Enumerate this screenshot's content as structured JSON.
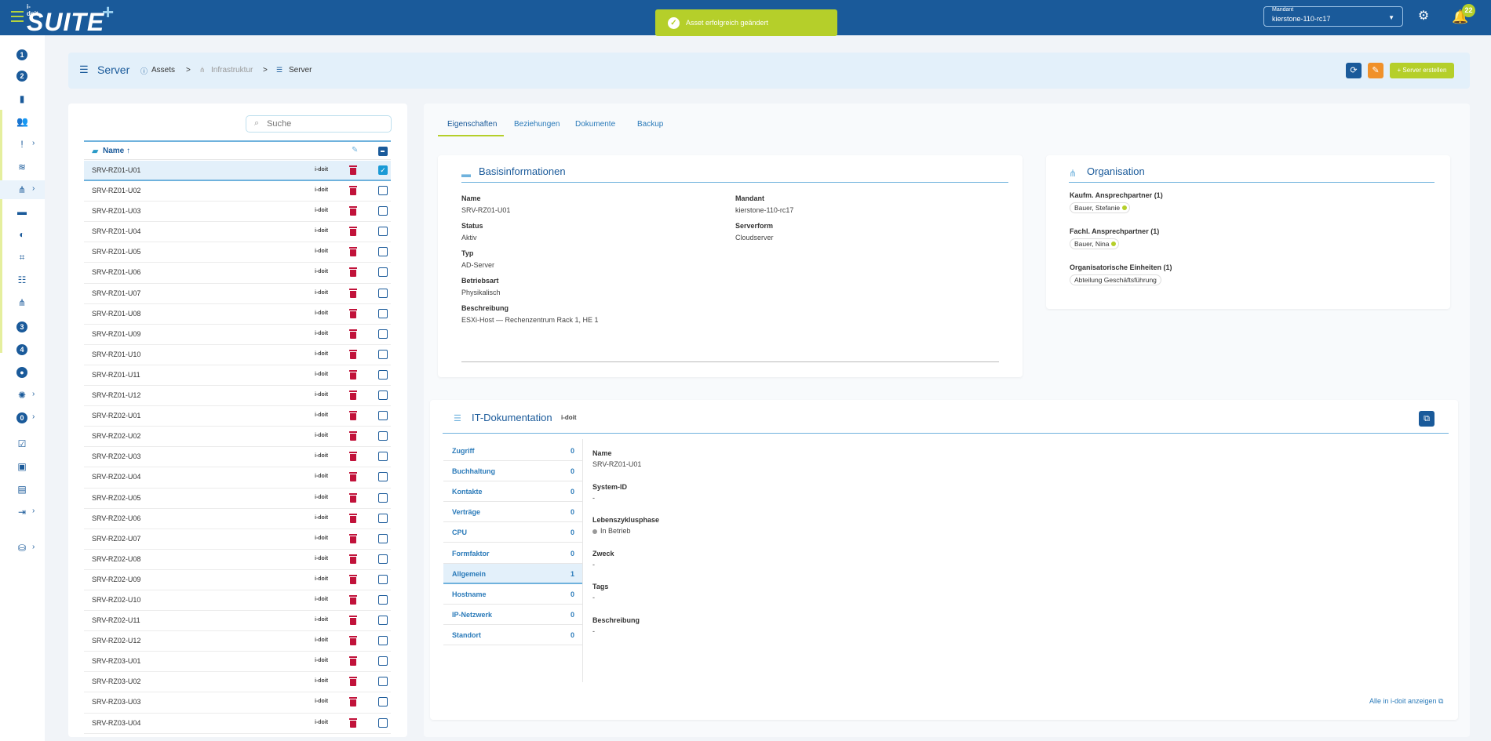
{
  "app": {
    "logo_sub": "i-doit",
    "logo_main": "SUITE",
    "logo_plus": "+"
  },
  "toast": {
    "message": "Asset erfolgreich geändert"
  },
  "topbar": {
    "mandant_label": "Mandant",
    "mandant_value": "kierstone-110-rc17",
    "notifications": "22"
  },
  "sidebar": {
    "items": [
      {
        "icon": "one-circle-icon",
        "glyph": "1",
        "circle": true,
        "chev": false
      },
      {
        "icon": "two-circle-icon",
        "glyph": "2",
        "circle": true,
        "chev": false
      },
      {
        "icon": "bar-chart-icon",
        "glyph": "▮",
        "circle": false,
        "chev": false
      },
      {
        "icon": "users-icon",
        "glyph": "👥",
        "circle": false,
        "chev": false
      },
      {
        "icon": "alert-icon",
        "glyph": "!",
        "circle": false,
        "chev": true
      },
      {
        "icon": "layers-icon",
        "glyph": "≋",
        "circle": false,
        "chev": false
      },
      {
        "icon": "network-icon",
        "glyph": "⋔",
        "circle": false,
        "chev": true,
        "active": true
      },
      {
        "icon": "truck-icon",
        "glyph": "▬",
        "circle": false,
        "chev": false
      },
      {
        "icon": "toggle-icon",
        "glyph": "◐",
        "circle": false,
        "chev": false
      },
      {
        "icon": "scan-icon",
        "glyph": "⌗",
        "circle": false,
        "chev": false
      },
      {
        "icon": "tree-list-icon",
        "glyph": "☷",
        "circle": false,
        "chev": false
      },
      {
        "icon": "hierarchy-icon",
        "glyph": "⋔",
        "circle": false,
        "chev": false
      },
      {
        "icon": "three-circle-icon",
        "glyph": "3",
        "circle": true,
        "chev": false
      },
      {
        "icon": "four-circle-icon",
        "glyph": "4",
        "circle": true,
        "chev": false
      },
      {
        "icon": "drop-circle-icon",
        "glyph": "●",
        "circle": true,
        "chev": false
      },
      {
        "icon": "sun-alert-icon",
        "glyph": "✺",
        "circle": false,
        "chev": true
      },
      {
        "icon": "zero-circle-icon",
        "glyph": "0",
        "circle": true,
        "chev": true
      },
      {
        "icon": "checklist-icon",
        "glyph": "☑",
        "circle": false,
        "chev": false
      },
      {
        "icon": "image-report-icon",
        "glyph": "▣",
        "circle": false,
        "chev": false
      },
      {
        "icon": "document-icon",
        "glyph": "▤",
        "circle": false,
        "chev": false
      },
      {
        "icon": "login-icon",
        "glyph": "⇥",
        "circle": false,
        "chev": true
      },
      {
        "icon": "database-icon",
        "glyph": "⛁",
        "circle": false,
        "chev": true
      }
    ]
  },
  "header": {
    "title": "Server",
    "breadcrumb": [
      "Assets",
      "Infrastruktur",
      "Server"
    ],
    "separator": ">",
    "refresh_icon": "⟳",
    "edit_icon": "✎",
    "create_label": "+  Server erstellen"
  },
  "list": {
    "search_placeholder": "Suche",
    "column_name": "Name ↑",
    "idoit_label": "i-doit",
    "rows": [
      "SRV-RZ01-U01",
      "SRV-RZ01-U02",
      "SRV-RZ01-U03",
      "SRV-RZ01-U04",
      "SRV-RZ01-U05",
      "SRV-RZ01-U06",
      "SRV-RZ01-U07",
      "SRV-RZ01-U08",
      "SRV-RZ01-U09",
      "SRV-RZ01-U10",
      "SRV-RZ01-U11",
      "SRV-RZ01-U12",
      "SRV-RZ02-U01",
      "SRV-RZ02-U02",
      "SRV-RZ02-U03",
      "SRV-RZ02-U04",
      "SRV-RZ02-U05",
      "SRV-RZ02-U06",
      "SRV-RZ02-U07",
      "SRV-RZ02-U08",
      "SRV-RZ02-U09",
      "SRV-RZ02-U10",
      "SRV-RZ02-U11",
      "SRV-RZ02-U12",
      "SRV-RZ03-U01",
      "SRV-RZ03-U02",
      "SRV-RZ03-U03",
      "SRV-RZ03-U04"
    ],
    "selected_index": 0
  },
  "tabs": [
    "Eigenschaften",
    "Beziehungen",
    "Dokumente",
    "Backup"
  ],
  "basis": {
    "title": "Basisinformationen",
    "name_label": "Name",
    "name_value": "SRV-RZ01-U01",
    "status_label": "Status",
    "status_value": "Aktiv",
    "typ_label": "Typ",
    "typ_value": "AD-Server",
    "betriebsart_label": "Betriebsart",
    "betriebsart_value": "Physikalisch",
    "beschreibung_label": "Beschreibung",
    "beschreibung_value": "ESXi-Host — Rechenzentrum Rack 1, HE 1",
    "mandant_label": "Mandant",
    "mandant_value": "kierstone-110-rc17",
    "serverform_label": "Serverform",
    "serverform_value": "Cloudserver"
  },
  "organisation": {
    "title": "Organisation",
    "kaufm_label": "Kaufm. Ansprechpartner (1)",
    "kaufm_value": "Bauer, Stefanie",
    "fachl_label": "Fachl. Ansprechpartner (1)",
    "fachl_value": "Bauer, Nina",
    "einheiten_label": "Organisatorische Einheiten (1)",
    "einheiten_value": "Abteilung Geschäftsführung"
  },
  "itdoc": {
    "title": "IT-Dokumentation",
    "brand": "i-doit",
    "categories": [
      {
        "label": "Zugriff",
        "count": "0"
      },
      {
        "label": "Buchhaltung",
        "count": "0"
      },
      {
        "label": "Kontakte",
        "count": "0"
      },
      {
        "label": "Verträge",
        "count": "0"
      },
      {
        "label": "CPU",
        "count": "0"
      },
      {
        "label": "Formfaktor",
        "count": "0"
      },
      {
        "label": "Allgemein",
        "count": "1"
      },
      {
        "label": "Hostname",
        "count": "0"
      },
      {
        "label": "IP-Netzwerk",
        "count": "0"
      },
      {
        "label": "Standort",
        "count": "0"
      }
    ],
    "active_index": 6,
    "fields": [
      {
        "label": "Name",
        "value": "SRV-RZ01-U01"
      },
      {
        "label": "System-ID",
        "value": "-"
      },
      {
        "label": "Lebenszyklusphase",
        "value": "In Betrieb"
      },
      {
        "label": "Zweck",
        "value": "-"
      },
      {
        "label": "Tags",
        "value": "-"
      },
      {
        "label": "Beschreibung",
        "value": "-"
      }
    ],
    "show_all_label": "Alle in i-doit anzeigen ⧉"
  },
  "colors": {
    "primary": "#1a5a9a",
    "accent_green": "#b5cf2a",
    "orange": "#f0912a",
    "danger": "#c1123a",
    "light_blue": "#e3f0fa"
  }
}
